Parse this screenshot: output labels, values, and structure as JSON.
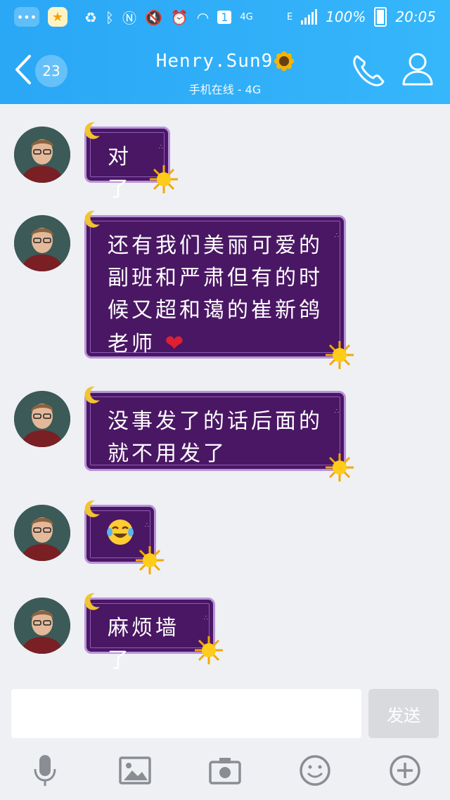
{
  "status_bar": {
    "left_badge_icon": "message-dots-icon",
    "left_badge2_icon": "qq-star-icon",
    "sim_label": "1",
    "network_label": "4G",
    "e_label": "E",
    "battery_percent": "100%",
    "time": "20:05"
  },
  "header": {
    "unread_count": "23",
    "contact_name": "Henry.Sun9",
    "contact_status": "手机在线 - 4G",
    "accent_color": "#2aa7f5"
  },
  "messages": [
    {
      "text_lines": [
        "对了"
      ],
      "has_heart": false
    },
    {
      "text_lines": [
        "还有我们美丽可爱的",
        "副班和严肃但有的时",
        "候又超和蔼的崔新鸽"
      ],
      "last_line": "老师",
      "has_heart": true
    },
    {
      "text_lines": [
        "没事发了的话后面的",
        "就不用发了"
      ],
      "has_heart": false
    },
    {
      "emoji": "😂",
      "text_lines": []
    },
    {
      "text_lines": [
        "麻烦墙了"
      ],
      "has_heart": false
    }
  ],
  "input": {
    "value": "",
    "placeholder": "",
    "send_label": "发送"
  },
  "toolbar": {
    "items": [
      "microphone-icon",
      "image-icon",
      "camera-icon",
      "emoji-icon",
      "plus-icon"
    ]
  },
  "bubble_color": "#4a1764"
}
